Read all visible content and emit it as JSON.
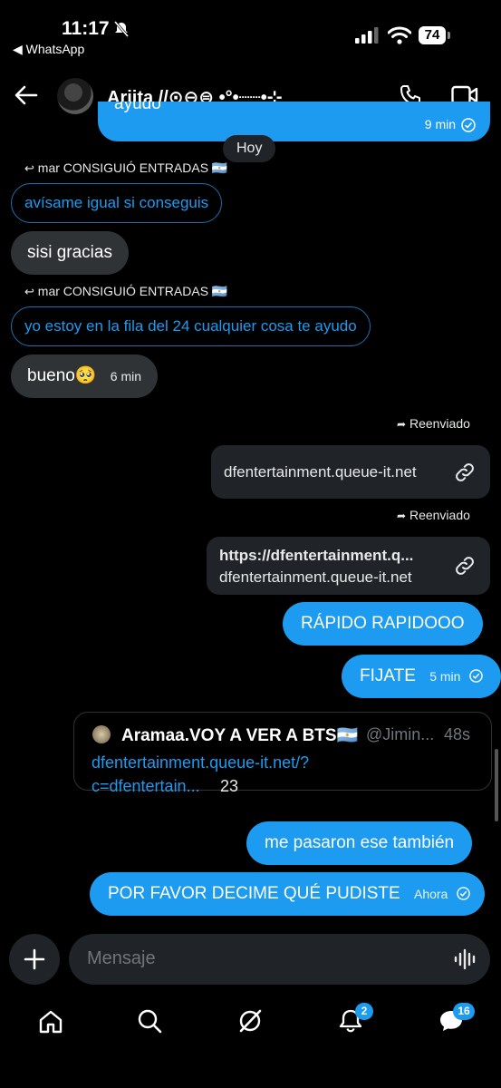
{
  "status_bar": {
    "time": "11:17",
    "back_app": "◀ WhatsApp",
    "battery": "74"
  },
  "header": {
    "contact_name": "Ariita //⊙⊖⊜ •°•┈┈•⊹"
  },
  "messages": {
    "top_partial": {
      "text": "ayudo",
      "time": "9 min"
    },
    "date_separator": "Hoy",
    "reply1": {
      "label": "mar CONSIGUIÓ ENTRADAS 🇦🇷",
      "quote": "avísame igual si conseguis"
    },
    "in1": {
      "text": "sisi gracias"
    },
    "reply2": {
      "label": "mar CONSIGUIÓ ENTRADAS 🇦🇷",
      "quote": "yo estoy en la fila del 24 cualquier cosa te ayudo"
    },
    "in2": {
      "text": "bueno🥺",
      "time": "6 min"
    },
    "fwd1": {
      "label": "Reenviado",
      "domain": "dfentertainment.queue-it.net"
    },
    "fwd2": {
      "label": "Reenviado",
      "url": "https://dfentertainment.q...",
      "domain": "dfentertainment.queue-it.net"
    },
    "out1": {
      "text": "RÁPIDO RAPIDOOO"
    },
    "out2": {
      "text": "FIJATE",
      "time": "5 min"
    },
    "quote_post": {
      "author": "Aramaa.VOY A VER A BTS🇦🇷",
      "handle": "@Jimin...",
      "age": "48s",
      "link_line1": "dfentertainment.queue-it.net/?",
      "link_line2": "c=dfentertain...",
      "suffix": "23"
    },
    "out3": {
      "text": "me pasaron ese también"
    },
    "out4": {
      "text": "POR FAVOR DECIME QUÉ PUDISTE",
      "time": "Ahora"
    }
  },
  "composer": {
    "placeholder": "Mensaje"
  },
  "bottom_nav": {
    "notifications_badge": "2",
    "messages_badge": "16"
  },
  "colors": {
    "accent": "#1d9bf0",
    "background": "#000000",
    "bubble_in": "#2f3336"
  }
}
